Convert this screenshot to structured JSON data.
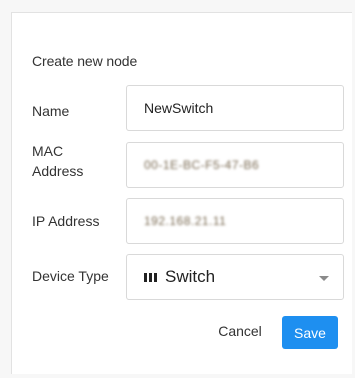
{
  "dialog": {
    "title": "Create new node",
    "name_label": "Name",
    "name_value": "NewSwitch",
    "mac_label_line1": "MAC",
    "mac_label_line2": "Address",
    "mac_value": "00-1E-BC-F5-47-B6",
    "ip_label": "IP Address",
    "ip_value": "192.168.21.11",
    "device_type_label": "Device Type",
    "device_type_value": "Switch",
    "device_type_icon": "switch-device-icon",
    "cancel_label": "Cancel",
    "save_label": "Save",
    "colors": {
      "primary": "#1e8ff0",
      "border": "#d9d9d9",
      "text": "#333333"
    }
  }
}
